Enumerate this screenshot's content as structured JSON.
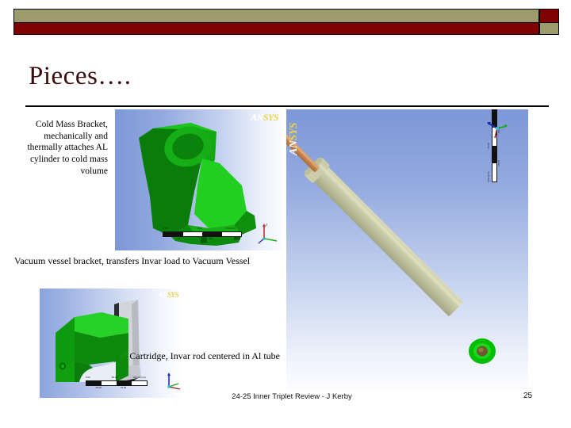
{
  "slide": {
    "title": "Pieces….",
    "title_color": "#3b0d0d",
    "background_color": "#ffffff"
  },
  "banner": {
    "tan_color": "#9d9a6e",
    "dark_red_color": "#7e0000",
    "border_color": "#000000"
  },
  "captions": {
    "cold_mass_bracket": "Cold Mass Bracket, mechanically and thermally attaches AL cylinder to cold mass volume",
    "vacuum_vessel_bracket": "Vacuum vessel bracket, transfers Invar load to Vacuum Vessel",
    "cartridge": "Cartridge, Invar rod centered in Al tube"
  },
  "images": {
    "cold_mass_bracket_view": {
      "watermark": "ANSYS",
      "watermark_part_white": "AN",
      "watermark_part_yellow": "SYS",
      "part_color": "#12b012",
      "background_gradient_from": "#7d98d8",
      "background_gradient_to": "#fbfcfe",
      "scale_labels": [
        "1.50",
        "45.0",
        "0.0 (mm)",
        "7.5",
        "45.0"
      ]
    },
    "cartridge_rod_view": {
      "watermark": "ANSYS",
      "watermark_part_white": "AN",
      "watermark_part_yellow": "SYS",
      "tube_color": "#c5c6a2",
      "rod_color": "#c98a52",
      "end_ring_color": "#00c000",
      "background_gradient_from": "#7d98d8",
      "background_gradient_to": "#fdfdff",
      "scale_labels": [
        "0.00 (mm)",
        "25.00",
        "15.00",
        "50.00",
        "7.50"
      ]
    },
    "vacuum_vessel_bracket_view": {
      "watermark": "ANSYS",
      "watermark_part_white": "AN",
      "watermark_part_yellow": "SYS",
      "bracket_color": "#12b012",
      "vessel_color": "#b9bcc2",
      "background_gradient_from": "#8ba4dc",
      "background_gradient_to": "#ffffff",
      "scale_labels": [
        "0.00",
        "50.00",
        "100.00 (mm)",
        "25.00",
        "75.00"
      ]
    }
  },
  "footer": {
    "text": "24-25 Inner Triplet Review - J Kerby",
    "page_number": "25"
  }
}
